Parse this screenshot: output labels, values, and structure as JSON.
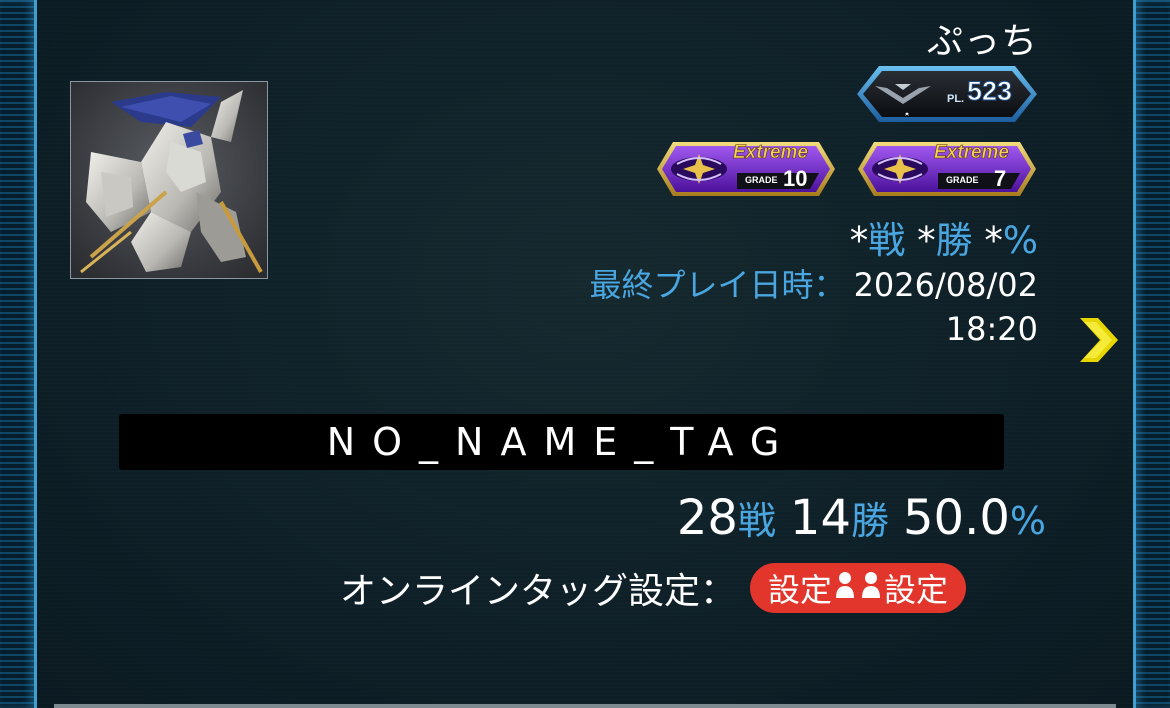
{
  "player": {
    "name": "ぷっち",
    "pilot_level_prefix": "PL.",
    "pilot_level": "523",
    "grades": [
      {
        "label": "Extreme",
        "grade_word": "GRADE",
        "grade": "10"
      },
      {
        "label": "Extreme",
        "grade_word": "GRADE",
        "grade": "7"
      }
    ]
  },
  "record": {
    "battles": "*",
    "battles_unit": "戦",
    "wins": "*",
    "wins_unit": "勝",
    "rate": "*",
    "rate_unit": "%"
  },
  "last_play": {
    "label": "最終プレイ日時：",
    "date": "2026/08/02",
    "time": "18:20"
  },
  "tag": {
    "name": "NO_NAME_TAG",
    "battles": "28",
    "battles_unit": "戦",
    "wins": "14",
    "wins_unit": "勝",
    "rate": "50.0",
    "rate_unit": "%"
  },
  "online_tag": {
    "label": "オンラインタッグ設定：",
    "button_left": "設定",
    "button_right": "設定"
  },
  "icons": {
    "next": "chevron-right-icon",
    "person": "person-icon"
  },
  "colors": {
    "accent_blue": "#4aa6e0",
    "button_red": "#e2362c",
    "chevron_yellow": "#e6d600",
    "grade_purple": "#7b2fd6"
  }
}
